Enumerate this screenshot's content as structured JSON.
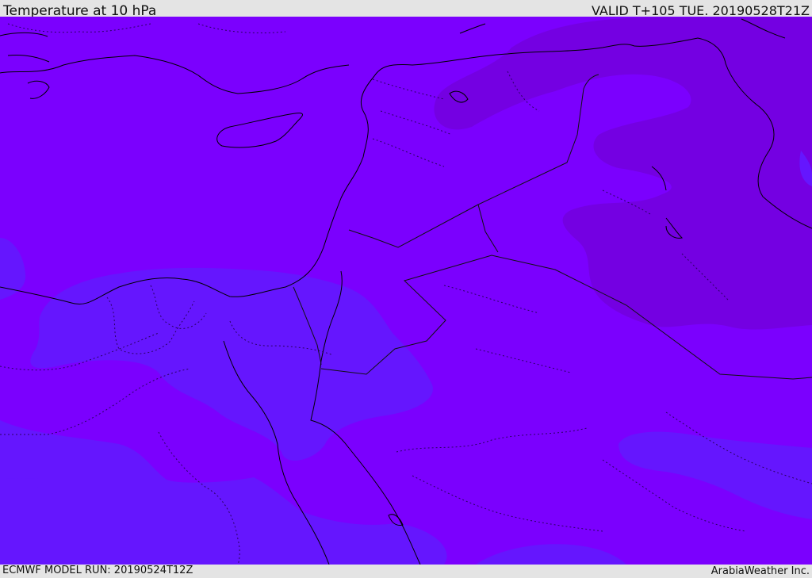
{
  "header": {
    "title": "Temperature at 10 hPa",
    "valid": "VALID T+105 TUE. 20190528T21Z"
  },
  "footer": {
    "model_run": "ECMWF MODEL RUN: 20190524T12Z",
    "credit": "ArabiaWeather Inc."
  },
  "colors": {
    "background": "#7b00fe",
    "warm_zone": "#7400e2",
    "cool_zone": "#6516fe",
    "coastline": "#000000",
    "border": "#2a0060",
    "frame": "#e4e4e4"
  }
}
